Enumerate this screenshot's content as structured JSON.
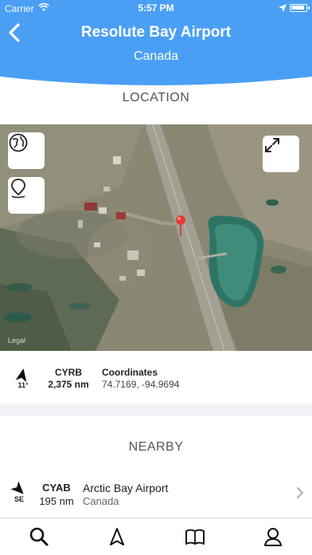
{
  "status": {
    "carrier": "Carrier",
    "time": "5:57 PM"
  },
  "header": {
    "title": "Resolute Bay Airport",
    "subtitle": "Canada",
    "color": "#4a9ff5"
  },
  "location": {
    "section_label": "LOCATION",
    "map_legal": "Legal",
    "globe_button_icon": "globe-icon",
    "pin_button_icon": "location-pin-icon",
    "expand_button_icon": "expand-icon"
  },
  "info": {
    "heading_deg": "11°",
    "code": "CYRB",
    "distance": "2,375 nm",
    "coord_label": "Coordinates",
    "coord_value": "74.7169, -94.9694"
  },
  "nearby": {
    "section_label": "NEARBY",
    "items": [
      {
        "direction": "SE",
        "code": "CYAB",
        "distance": "195 nm",
        "name": "Arctic Bay Airport",
        "country": "Canada"
      }
    ]
  },
  "tabbar": {
    "tabs": [
      "search-icon",
      "navigation-arrow-icon",
      "map-icon",
      "profile-icon"
    ]
  }
}
